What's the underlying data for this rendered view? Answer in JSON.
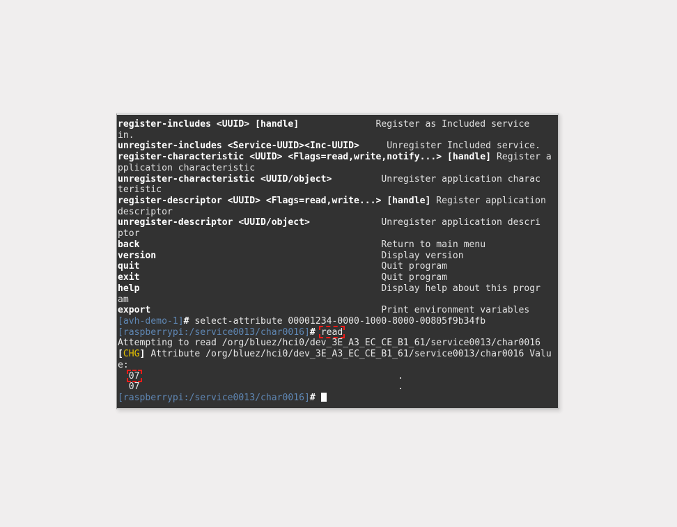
{
  "window": {
    "type": "terminal",
    "background_color": "#323232",
    "text_color": "#e6e6e6",
    "prompt_color": "#5f87b4",
    "highlight_color": "#ee1c18",
    "accent_color": "#e5c100"
  },
  "lines": [
    {
      "id": "l01",
      "segments": [
        {
          "text": "register-includes <UUID> [handle]",
          "style": "cmd"
        },
        {
          "text": "              ",
          "style": "plain"
        },
        {
          "text": "Register as Included service",
          "style": "desc"
        }
      ]
    },
    {
      "id": "l02",
      "segments": [
        {
          "text": "in.",
          "style": "desc"
        }
      ]
    },
    {
      "id": "l03",
      "segments": [
        {
          "text": "unregister-includes <Service-UUID><Inc-UUID>",
          "style": "cmd"
        },
        {
          "text": "     ",
          "style": "plain"
        },
        {
          "text": "Unregister Included service.",
          "style": "desc"
        }
      ]
    },
    {
      "id": "l04",
      "segments": [
        {
          "text": "register-characteristic <UUID> <Flags=read,write,notify...> [handle]",
          "style": "cmd"
        },
        {
          "text": " ",
          "style": "plain"
        },
        {
          "text": "Register a",
          "style": "desc"
        }
      ]
    },
    {
      "id": "l05",
      "segments": [
        {
          "text": "pplication characteristic",
          "style": "desc"
        }
      ]
    },
    {
      "id": "l06",
      "segments": [
        {
          "text": "unregister-characteristic <UUID/object>",
          "style": "cmd"
        },
        {
          "text": "         ",
          "style": "plain"
        },
        {
          "text": "Unregister application charac",
          "style": "desc"
        }
      ]
    },
    {
      "id": "l07",
      "segments": [
        {
          "text": "teristic",
          "style": "desc"
        }
      ]
    },
    {
      "id": "l08",
      "segments": [
        {
          "text": "register-descriptor <UUID> <Flags=read,write...> [handle]",
          "style": "cmd"
        },
        {
          "text": " ",
          "style": "plain"
        },
        {
          "text": "Register application",
          "style": "desc"
        }
      ]
    },
    {
      "id": "l09",
      "segments": [
        {
          "text": "descriptor",
          "style": "desc"
        }
      ]
    },
    {
      "id": "l10",
      "segments": [
        {
          "text": "unregister-descriptor <UUID/object>",
          "style": "cmd"
        },
        {
          "text": "             ",
          "style": "plain"
        },
        {
          "text": "Unregister application descri",
          "style": "desc"
        }
      ]
    },
    {
      "id": "l11",
      "segments": [
        {
          "text": "ptor",
          "style": "desc"
        }
      ]
    },
    {
      "id": "l12",
      "segments": [
        {
          "text": "back",
          "style": "cmd"
        },
        {
          "text": "                                            ",
          "style": "plain"
        },
        {
          "text": "Return to main menu",
          "style": "desc"
        }
      ]
    },
    {
      "id": "l13",
      "segments": [
        {
          "text": "version",
          "style": "cmd"
        },
        {
          "text": "                                         ",
          "style": "plain"
        },
        {
          "text": "Display version",
          "style": "desc"
        }
      ]
    },
    {
      "id": "l14",
      "segments": [
        {
          "text": "quit",
          "style": "cmd"
        },
        {
          "text": "                                            ",
          "style": "plain"
        },
        {
          "text": "Quit program",
          "style": "desc"
        }
      ]
    },
    {
      "id": "l15",
      "segments": [
        {
          "text": "exit",
          "style": "cmd"
        },
        {
          "text": "                                            ",
          "style": "plain"
        },
        {
          "text": "Quit program",
          "style": "desc"
        }
      ]
    },
    {
      "id": "l16",
      "segments": [
        {
          "text": "help",
          "style": "cmd"
        },
        {
          "text": "                                            ",
          "style": "plain"
        },
        {
          "text": "Display help about this progr",
          "style": "desc"
        }
      ]
    },
    {
      "id": "l17",
      "segments": [
        {
          "text": "am",
          "style": "desc"
        }
      ]
    },
    {
      "id": "l18",
      "segments": [
        {
          "text": "export",
          "style": "cmd"
        },
        {
          "text": "                                          ",
          "style": "plain"
        },
        {
          "text": "Print environment variables",
          "style": "desc"
        }
      ]
    },
    {
      "id": "l19",
      "segments": [
        {
          "text": "[avh-demo-1]",
          "style": "prompt-blue"
        },
        {
          "text": "#",
          "style": "hash"
        },
        {
          "text": " select-attribute 00001234-0000-1000-8000-00805f9b34fb",
          "style": "plain"
        }
      ]
    },
    {
      "id": "l20",
      "segments": [
        {
          "text": "[raspberrypi:/service0013/char0016]",
          "style": "prompt-blue"
        },
        {
          "text": "#",
          "style": "hash"
        },
        {
          "text": " ",
          "style": "plain"
        },
        {
          "text": "read",
          "style": "plain",
          "highlight": true
        }
      ]
    },
    {
      "id": "l21",
      "segments": [
        {
          "text": "Attempting to read /org/bluez/hci0/dev_3E_A3_EC_CE_B1_61/service0013/char0016",
          "style": "plain"
        }
      ]
    },
    {
      "id": "l22",
      "segments": [
        {
          "text": "[",
          "style": "white-b"
        },
        {
          "text": "CHG",
          "style": "chg"
        },
        {
          "text": "]",
          "style": "white-b"
        },
        {
          "text": " Attribute /org/bluez/hci0/dev_3E_A3_EC_CE_B1_61/service0013/char0016 Valu",
          "style": "plain"
        }
      ]
    },
    {
      "id": "l23",
      "segments": [
        {
          "text": "e:",
          "style": "plain"
        }
      ]
    },
    {
      "id": "l24",
      "segments": [
        {
          "text": "  ",
          "style": "plain"
        },
        {
          "text": "07",
          "style": "plain",
          "highlight": true
        },
        {
          "text": "                                               ",
          "style": "plain"
        },
        {
          "text": ".",
          "style": "plain"
        }
      ]
    },
    {
      "id": "l25",
      "segments": [
        {
          "text": "  07",
          "style": "plain"
        },
        {
          "text": "                                               ",
          "style": "plain"
        },
        {
          "text": ".",
          "style": "plain"
        }
      ]
    },
    {
      "id": "l26",
      "segments": [
        {
          "text": "[raspberrypi:/service0013/char0016]",
          "style": "prompt-blue"
        },
        {
          "text": "#",
          "style": "hash"
        },
        {
          "text": " ",
          "style": "plain"
        },
        {
          "text": "",
          "style": "cursor"
        }
      ]
    }
  ],
  "commands": [
    {
      "name": "register-includes",
      "args": "<UUID> [handle]",
      "description": "Register as Included service in."
    },
    {
      "name": "unregister-includes",
      "args": "<Service-UUID><Inc-UUID>",
      "description": "Unregister Included service."
    },
    {
      "name": "register-characteristic",
      "args": "<UUID> <Flags=read,write,notify...> [handle]",
      "description": "Register application characteristic"
    },
    {
      "name": "unregister-characteristic",
      "args": "<UUID/object>",
      "description": "Unregister application characteristic"
    },
    {
      "name": "register-descriptor",
      "args": "<UUID> <Flags=read,write...> [handle]",
      "description": "Register application descriptor"
    },
    {
      "name": "unregister-descriptor",
      "args": "<UUID/object>",
      "description": "Unregister application descriptor"
    },
    {
      "name": "back",
      "args": "",
      "description": "Return to main menu"
    },
    {
      "name": "version",
      "args": "",
      "description": "Display version"
    },
    {
      "name": "quit",
      "args": "",
      "description": "Quit program"
    },
    {
      "name": "exit",
      "args": "",
      "description": "Quit program"
    },
    {
      "name": "help",
      "args": "",
      "description": "Display help about this program"
    },
    {
      "name": "export",
      "args": "",
      "description": "Print environment variables"
    }
  ],
  "session": {
    "first_prompt": "[avh-demo-1]#",
    "first_command": "select-attribute 00001234-0000-1000-8000-00805f9b34fb",
    "uuid": "00001234-0000-1000-8000-00805f9b34fb",
    "second_prompt": "[raspberrypi:/service0013/char0016]#",
    "second_command": "read",
    "attempt_message": "Attempting to read /org/bluez/hci0/dev_3E_A3_EC_CE_B1_61/service0013/char0016",
    "event_tag": "CHG",
    "event_message": "Attribute /org/bluez/hci0/dev_3E_A3_EC_CE_B1_61/service0013/char0016 Value:",
    "device_path": "/org/bluez/hci0/dev_3E_A3_EC_CE_B1_61/service0013/char0016",
    "hex_values": [
      "07",
      "07"
    ],
    "ascii_values": [
      ".",
      "."
    ],
    "final_prompt": "[raspberrypi:/service0013/char0016]#"
  }
}
